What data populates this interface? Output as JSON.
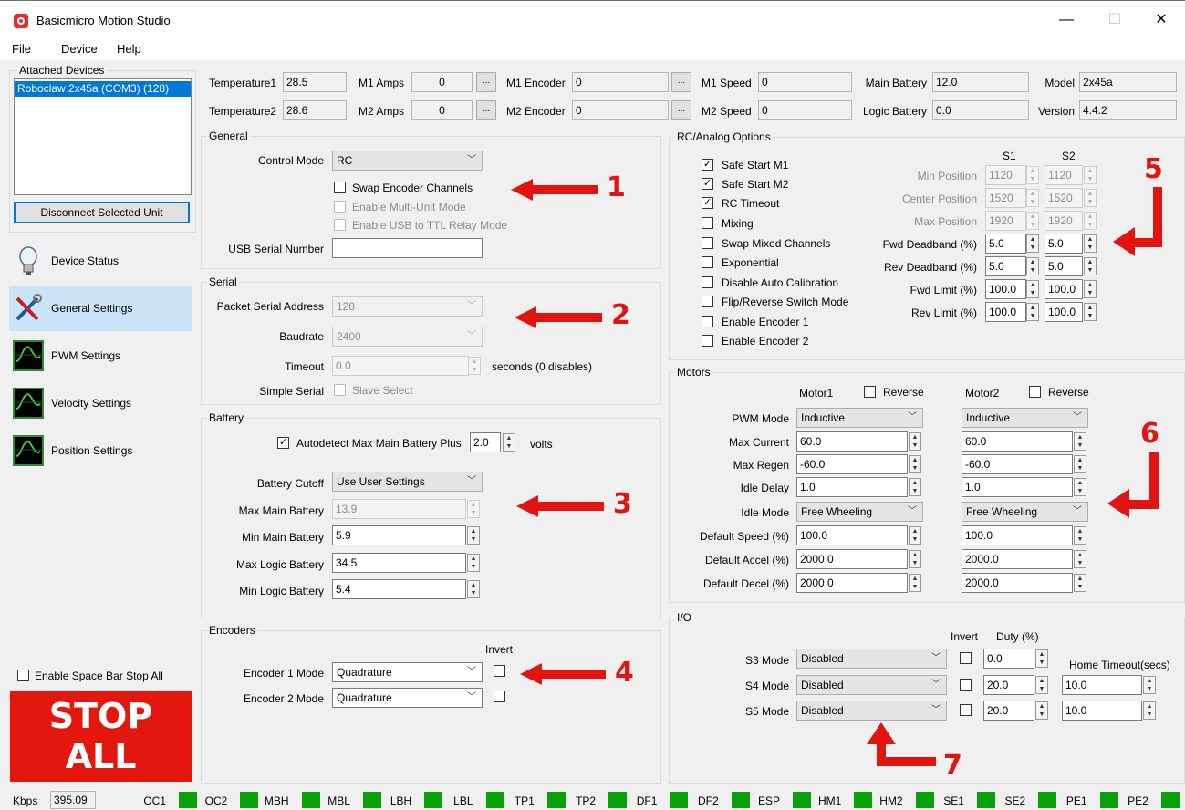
{
  "window": {
    "title": "Basicmicro Motion Studio"
  },
  "menu": [
    "File",
    "Device",
    "Help"
  ],
  "sidebar": {
    "attached_label": "Attached Devices",
    "device": "Roboclaw 2x45a (COM3) (128)",
    "disconnect": "Disconnect Selected Unit",
    "nav": [
      "Device Status",
      "General Settings",
      "PWM Settings",
      "Velocity Settings",
      "Position Settings"
    ],
    "space_bar": "Enable Space Bar Stop All",
    "stop": [
      "STOP",
      "ALL"
    ]
  },
  "readouts": {
    "temp1_label": "Temperature1",
    "temp1": "28.5",
    "temp2_label": "Temperature2",
    "temp2": "28.6",
    "m1amps_label": "M1 Amps",
    "m1amps": "0",
    "m2amps_label": "M2 Amps",
    "m2amps": "0",
    "m1enc_label": "M1 Encoder",
    "m1enc": "0",
    "m2enc_label": "M2 Encoder",
    "m2enc": "0",
    "m1spd_label": "M1 Speed",
    "m1spd": "0",
    "m2spd_label": "M2 Speed",
    "m2spd": "0",
    "mainbat_label": "Main Battery",
    "mainbat": "12.0",
    "logicbat_label": "Logic Battery",
    "logicbat": "0.0",
    "model_label": "Model",
    "model": "2x45a",
    "version_label": "Version",
    "version": "4.4.2",
    "dots": "..."
  },
  "general": {
    "title": "General",
    "control_mode_label": "Control Mode",
    "control_mode": "RC",
    "swap_encoder": "Swap Encoder Channels",
    "multi_unit": "Enable Multi-Unit Mode",
    "usb_ttl": "Enable USB to TTL Relay Mode",
    "usb_serial_label": "USB Serial Number",
    "usb_serial": ""
  },
  "serial": {
    "title": "Serial",
    "address_label": "Packet Serial Address",
    "address": "128",
    "baud_label": "Baudrate",
    "baud": "2400",
    "timeout_label": "Timeout",
    "timeout": "0.0",
    "timeout_suffix": "seconds (0 disables)",
    "simple_label": "Simple Serial",
    "slave": "Slave Select"
  },
  "battery": {
    "title": "Battery",
    "autodetect": "Autodetect Max Main Battery Plus",
    "autodetect_val": "2.0",
    "volts": "volts",
    "cutoff_label": "Battery Cutoff",
    "cutoff": "Use User Settings",
    "max_main_label": "Max Main Battery",
    "max_main": "13.9",
    "min_main_label": "Min Main Battery",
    "min_main": "5.9",
    "max_logic_label": "Max Logic Battery",
    "max_logic": "34.5",
    "min_logic_label": "Min Logic Battery",
    "min_logic": "5.4"
  },
  "encoders": {
    "title": "Encoders",
    "invert": "Invert",
    "enc1_label": "Encoder 1 Mode",
    "enc1": "Quadrature",
    "enc2_label": "Encoder 2 Mode",
    "enc2": "Quadrature"
  },
  "rc": {
    "title": "RC/Analog Options",
    "checks": [
      "Safe Start M1",
      "Safe Start M2",
      "RC Timeout",
      "Mixing",
      "Swap Mixed Channels",
      "Exponential",
      "Disable Auto Calibration",
      "Flip/Reverse Switch Mode",
      "Enable Encoder 1",
      "Enable Encoder 2"
    ],
    "checked": [
      "✓",
      "✓",
      "✓",
      "",
      "",
      "",
      "",
      "",
      "",
      ""
    ],
    "s1": "S1",
    "s2": "S2",
    "rows": [
      {
        "label": "Min Position",
        "s1": "1120",
        "s2": "1120"
      },
      {
        "label": "Center Position",
        "s1": "1520",
        "s2": "1520"
      },
      {
        "label": "Max Position",
        "s1": "1920",
        "s2": "1920"
      },
      {
        "label": "Fwd Deadband (%)",
        "s1": "5.0",
        "s2": "5.0"
      },
      {
        "label": "Rev Deadband (%)",
        "s1": "5.0",
        "s2": "5.0"
      },
      {
        "label": "Fwd Limit (%)",
        "s1": "100.0",
        "s2": "100.0"
      },
      {
        "label": "Rev Limit (%)",
        "s1": "100.0",
        "s2": "100.0"
      }
    ]
  },
  "motors": {
    "title": "Motors",
    "motor1": "Motor1",
    "motor2": "Motor2",
    "reverse": "Reverse",
    "rows": [
      {
        "label": "PWM Mode",
        "m1": "Inductive",
        "m2": "Inductive"
      },
      {
        "label": "Max Current",
        "m1": "60.0",
        "m2": "60.0"
      },
      {
        "label": "Max Regen",
        "m1": "-60.0",
        "m2": "-60.0"
      },
      {
        "label": "Idle Delay",
        "m1": "1.0",
        "m2": "1.0"
      },
      {
        "label": "Idle Mode",
        "m1": "Free Wheeling",
        "m2": "Free Wheeling"
      },
      {
        "label": "Default Speed (%)",
        "m1": "100.0",
        "m2": "100.0"
      },
      {
        "label": "Default Accel (%)",
        "m1": "2000.0",
        "m2": "2000.0"
      },
      {
        "label": "Default Decel (%)",
        "m1": "2000.0",
        "m2": "2000.0"
      }
    ]
  },
  "io": {
    "title": "I/O",
    "invert": "Invert",
    "duty": "Duty (%)",
    "home": "Home Timeout(secs)",
    "rows": [
      {
        "label": "S3 Mode",
        "mode": "Disabled",
        "duty": "0.0",
        "home": ""
      },
      {
        "label": "S4 Mode",
        "mode": "Disabled",
        "duty": "20.0",
        "home": "10.0"
      },
      {
        "label": "S5 Mode",
        "mode": "Disabled",
        "duty": "20.0",
        "home": "10.0"
      }
    ]
  },
  "annotations": [
    "1",
    "2",
    "3",
    "4",
    "5",
    "6",
    "7"
  ],
  "status": {
    "kbps_label": "Kbps",
    "kbps": "395.09",
    "leds": [
      "OC1",
      "OC2",
      "MBH",
      "MBL",
      "LBH",
      "LBL",
      "TP1",
      "TP2",
      "DF1",
      "DF2",
      "ESP",
      "HM1",
      "HM2",
      "SE1",
      "SE2",
      "PE1",
      "PE2"
    ],
    "led_color": "#0aa20a"
  },
  "colors": {
    "accent": "#0078d7",
    "stop": "#e3170e",
    "annotation": "#e3140f"
  }
}
